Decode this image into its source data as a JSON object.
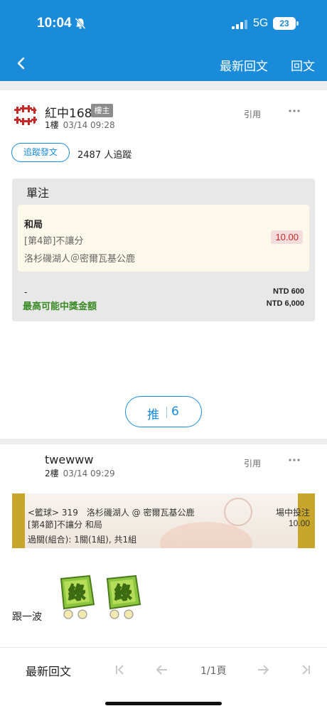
{
  "status_bar": {
    "time": "10:04",
    "network": "5G",
    "battery": "23",
    "icons": [
      "bell-slash-icon",
      "signal-icon",
      "battery-icon"
    ]
  },
  "nav": {
    "back_icon": "chevron-left-icon",
    "latest_reply": "最新回文",
    "reply": "回文"
  },
  "posts": [
    {
      "username": "紅中168",
      "badge": "樓主",
      "floor": "1樓",
      "datetime": "03/14 09:28",
      "quote": "引用",
      "follow_button": "追蹤發文",
      "followers": "2487 人追蹤",
      "bet_card": {
        "title": "單注",
        "selection": "和局",
        "market": "[第4節]不讓分",
        "odds": "10.00",
        "match": "洛杉磯湖人＠密爾瓦基公鹿",
        "dash": "-",
        "stake": "NTD 600",
        "max_win_label": "最高可能中獎金額",
        "max_win": "NTD 6,000"
      },
      "push": {
        "label": "推",
        "count": "6"
      }
    },
    {
      "username": "twewww",
      "floor": "2樓",
      "datetime": "03/14 09:29",
      "quote": "引用",
      "ticket": {
        "line1": "<籃球> 319　洛杉磯湖人 @ 密爾瓦基公鹿",
        "line1_right": "場中投注",
        "line2": "[第4節]不讓分 和局",
        "line2_right": "10.00",
        "line3": "過關(組合): 1關(1組), 共1組"
      },
      "text": "跟一波",
      "stickers": [
        "綠",
        "綠"
      ]
    }
  ],
  "bottom_bar": {
    "latest_reply": "最新回文",
    "page": "1/1頁",
    "icons": [
      "first-page-icon",
      "prev-page-icon",
      "next-page-icon",
      "last-page-icon"
    ]
  },
  "colors": {
    "brand_blue": "#1a8bd9",
    "odds_red": "#c62828",
    "win_green": "#3a8a25"
  }
}
